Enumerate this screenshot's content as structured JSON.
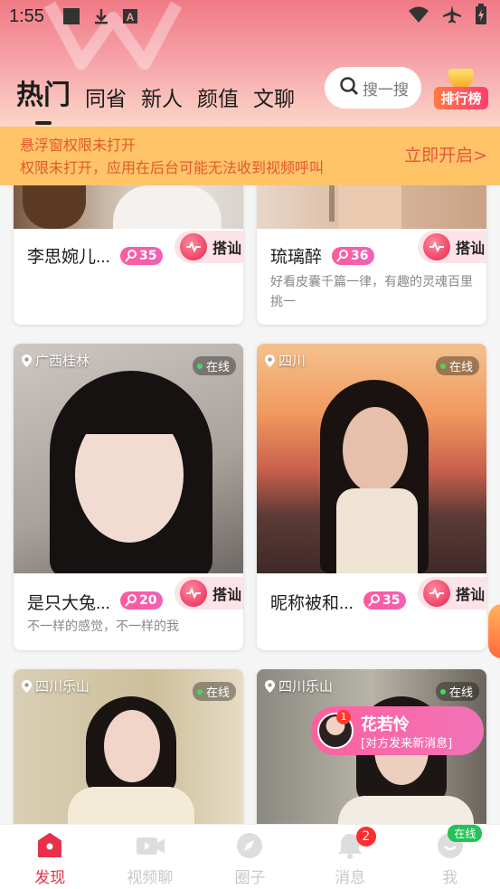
{
  "status_bar": {
    "time": "1:55",
    "icons": [
      "square-icon",
      "download-icon",
      "a-icon",
      "wifi-icon",
      "airplane-icon",
      "battery-icon"
    ]
  },
  "tabs": [
    {
      "label": "热门",
      "active": true
    },
    {
      "label": "同省",
      "active": false
    },
    {
      "label": "新人",
      "active": false
    },
    {
      "label": "颜值",
      "active": false
    },
    {
      "label": "文聊",
      "active": false
    }
  ],
  "search": {
    "placeholder": "搜一搜"
  },
  "ranking": {
    "label": "排行榜"
  },
  "banner": {
    "line1": "悬浮窗权限未打开",
    "line2": "权限未打开，应用在后台可能无法收到视频呼叫",
    "action": "立即开启>"
  },
  "cards": [
    {
      "name": "李思婉儿...",
      "level": "35",
      "chat": "搭讪",
      "bio": ""
    },
    {
      "name": "琉璃醉",
      "level": "36",
      "chat": "搭讪",
      "bio": "好看皮囊千篇一律，有趣的灵魂百里挑一"
    },
    {
      "location": "广西桂林",
      "status": "在线",
      "name": "是只大兔...",
      "level": "20",
      "chat": "搭讪",
      "bio": "不一样的感觉，不一样的我"
    },
    {
      "location": "四川",
      "status": "在线",
      "name": "昵称被和...",
      "level": "35",
      "chat": "搭讪",
      "bio": ""
    },
    {
      "location": "四川乐山",
      "status": "在线"
    },
    {
      "location": "四川乐山",
      "status": "在线"
    }
  ],
  "notification": {
    "count": "1",
    "name": "花若怜",
    "message": "[对方发来新消息]"
  },
  "bottom_nav": [
    {
      "label": "发现",
      "active": true
    },
    {
      "label": "视频聊",
      "active": false
    },
    {
      "label": "圈子",
      "active": false
    },
    {
      "label": "消息",
      "active": false,
      "badge": "2"
    },
    {
      "label": "我",
      "active": false,
      "tag": "在线"
    }
  ],
  "colors": {
    "accent": "#e8304a",
    "badge": "#f062b8",
    "banner_bg": "#ffc468",
    "banner_text": "#e05a2c"
  }
}
